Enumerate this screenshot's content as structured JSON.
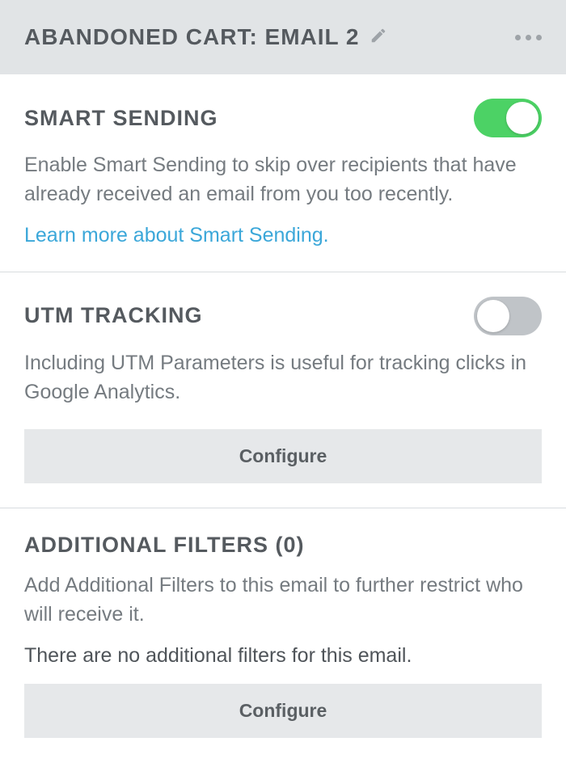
{
  "header": {
    "title": "ABANDONED CART: EMAIL 2"
  },
  "sections": {
    "smart_sending": {
      "title": "SMART SENDING",
      "desc": "Enable Smart Sending to skip over recipients that have already received an email from you too recently.",
      "link": "Learn more about Smart Sending.",
      "toggle_on": true
    },
    "utm": {
      "title": "UTM TRACKING",
      "desc": "Including UTM Parameters is useful for tracking clicks in Google Analytics.",
      "button": "Configure",
      "toggle_on": false
    },
    "filters": {
      "title": "ADDITIONAL FILTERS (0)",
      "desc": "Add Additional Filters to this email to further restrict who will receive it.",
      "empty": "There are no additional filters for this email.",
      "button": "Configure"
    }
  }
}
